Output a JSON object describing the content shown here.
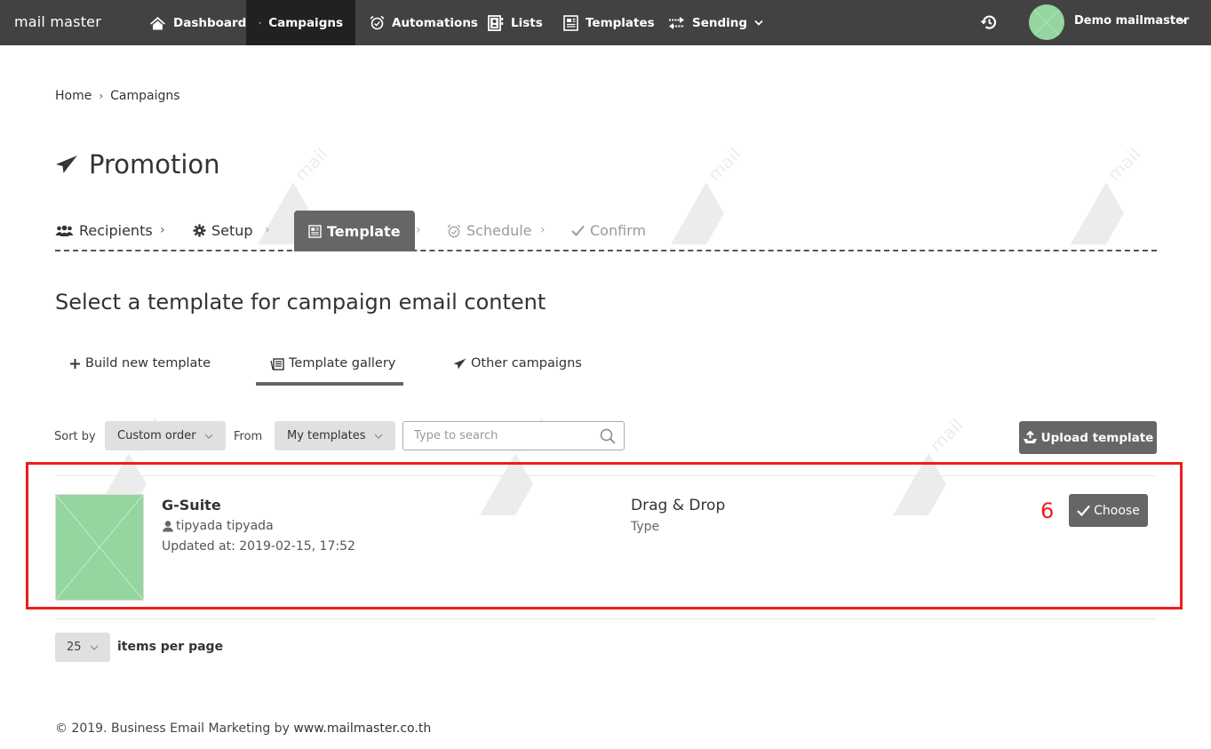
{
  "app": {
    "logo": "mail master"
  },
  "nav": {
    "items": [
      {
        "label": "Dashboard",
        "icon": "home-icon",
        "active": false
      },
      {
        "label": "Campaigns",
        "icon": "paper-plane-icon",
        "active": true
      },
      {
        "label": "Automations",
        "icon": "alarm-clock-icon",
        "active": false
      },
      {
        "label": "Lists",
        "icon": "address-book-icon",
        "active": false
      },
      {
        "label": "Templates",
        "icon": "newspaper-icon",
        "active": false
      },
      {
        "label": "Sending",
        "icon": "exchange-arrows-icon",
        "active": false,
        "has_dropdown": true
      }
    ],
    "user_name": "Demo mailmaster"
  },
  "breadcrumb": {
    "items": [
      "Home",
      "Campaigns"
    ],
    "separator": "›"
  },
  "page": {
    "title": "Promotion",
    "section_title": "Select a template for campaign email content"
  },
  "steps": {
    "items": [
      {
        "label": "Recipients",
        "icon": "users-icon",
        "state": "done"
      },
      {
        "label": "Setup",
        "icon": "gear-icon",
        "state": "done"
      },
      {
        "label": "Template",
        "icon": "newspaper-icon",
        "state": "active"
      },
      {
        "label": "Schedule",
        "icon": "alarm-clock-icon",
        "state": "pending"
      },
      {
        "label": "Confirm",
        "icon": "check-icon",
        "state": "pending"
      }
    ],
    "separator": "›"
  },
  "tabs": {
    "items": [
      {
        "label": "Build new template",
        "icon": "plus-icon",
        "active": false
      },
      {
        "label": "Template gallery",
        "icon": "gallery-icon",
        "active": true
      },
      {
        "label": "Other campaigns",
        "icon": "paper-plane-icon",
        "active": false
      }
    ]
  },
  "filters": {
    "sort_label": "Sort by",
    "sort_value": "Custom order",
    "from_label": "From",
    "from_value": "My templates",
    "search_placeholder": "Type to search",
    "search_value": "",
    "upload_label": "Upload template"
  },
  "templates": [
    {
      "name": "G-Suite",
      "author": "tipyada tipyada",
      "updated": "Updated at: 2019-02-15, 17:52",
      "type_value": "Drag & Drop",
      "type_label": "Type",
      "choose_label": "Choose"
    }
  ],
  "annotation": {
    "label": "6",
    "color": "#ee1c1c"
  },
  "pagination": {
    "per_page": "25",
    "per_page_label": "items per page"
  },
  "footer": {
    "text": "© 2019. Business Email Marketing by ",
    "link": "www.mailmaster.co.th"
  },
  "colors": {
    "topbar": "#424242",
    "nav_active": "#212121",
    "button": "#666666",
    "placeholder_green": "#95d59f",
    "highlight": "#ee1c1c"
  }
}
